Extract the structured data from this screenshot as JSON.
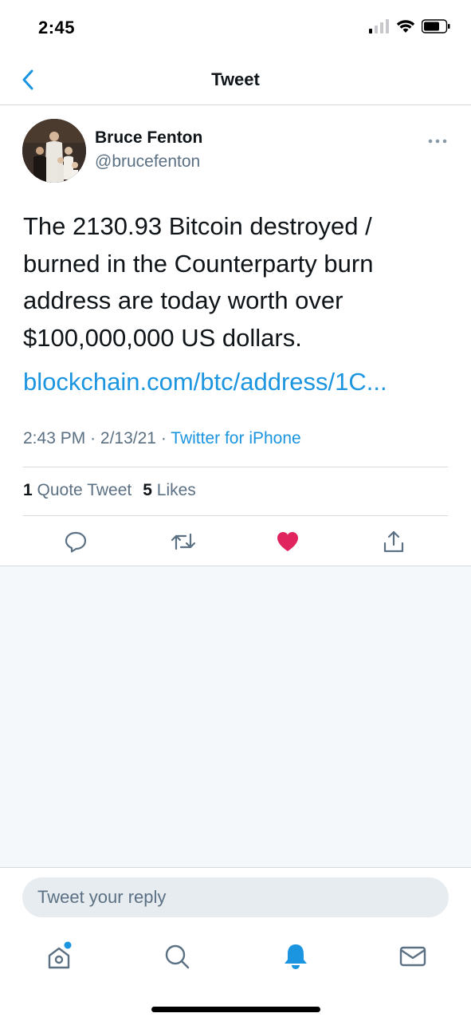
{
  "status_bar": {
    "time": "2:45"
  },
  "nav": {
    "title": "Tweet",
    "back_icon": "chevron-left-icon"
  },
  "tweet": {
    "author_name": "Bruce Fenton",
    "author_handle": "@brucefenton",
    "text": "The 2130.93 Bitcoin destroyed / burned in the Counterparty burn address are today worth over $100,000,000 US dollars.",
    "link": "blockchain.com/btc/address/1C...",
    "time": "2:43 PM",
    "date": "2/13/21",
    "separator": "·",
    "source": "Twitter for iPhone",
    "stats": {
      "quote_count": "1",
      "quote_label": "Quote Tweet",
      "likes_count": "5",
      "likes_label": "Likes"
    },
    "liked": true
  },
  "reply": {
    "placeholder": "Tweet your reply"
  },
  "tab_bar": {
    "tabs": [
      {
        "icon": "home-icon",
        "has_dot": true
      },
      {
        "icon": "search-icon"
      },
      {
        "icon": "bell-icon",
        "active": true
      },
      {
        "icon": "mail-icon"
      }
    ]
  },
  "colors": {
    "accent": "#1b95e0",
    "like": "#e0245e",
    "secondary_text": "#5b7083",
    "divider": "#d6dadd",
    "background_empty": "#f5f8fa"
  }
}
